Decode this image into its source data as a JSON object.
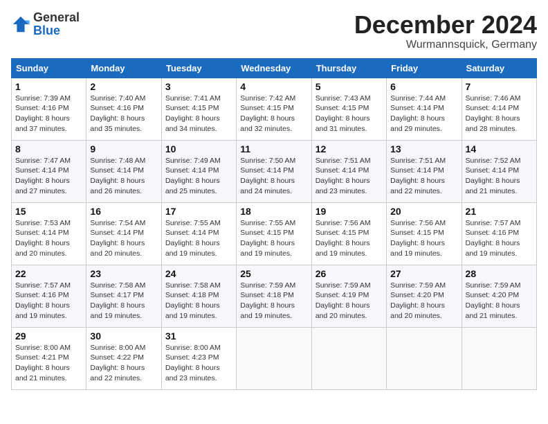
{
  "header": {
    "logo_general": "General",
    "logo_blue": "Blue",
    "month": "December 2024",
    "location": "Wurmannsquick, Germany"
  },
  "days_of_week": [
    "Sunday",
    "Monday",
    "Tuesday",
    "Wednesday",
    "Thursday",
    "Friday",
    "Saturday"
  ],
  "weeks": [
    [
      {
        "day": 1,
        "info": "Sunrise: 7:39 AM\nSunset: 4:16 PM\nDaylight: 8 hours\nand 37 minutes."
      },
      {
        "day": 2,
        "info": "Sunrise: 7:40 AM\nSunset: 4:16 PM\nDaylight: 8 hours\nand 35 minutes."
      },
      {
        "day": 3,
        "info": "Sunrise: 7:41 AM\nSunset: 4:15 PM\nDaylight: 8 hours\nand 34 minutes."
      },
      {
        "day": 4,
        "info": "Sunrise: 7:42 AM\nSunset: 4:15 PM\nDaylight: 8 hours\nand 32 minutes."
      },
      {
        "day": 5,
        "info": "Sunrise: 7:43 AM\nSunset: 4:15 PM\nDaylight: 8 hours\nand 31 minutes."
      },
      {
        "day": 6,
        "info": "Sunrise: 7:44 AM\nSunset: 4:14 PM\nDaylight: 8 hours\nand 29 minutes."
      },
      {
        "day": 7,
        "info": "Sunrise: 7:46 AM\nSunset: 4:14 PM\nDaylight: 8 hours\nand 28 minutes."
      }
    ],
    [
      {
        "day": 8,
        "info": "Sunrise: 7:47 AM\nSunset: 4:14 PM\nDaylight: 8 hours\nand 27 minutes."
      },
      {
        "day": 9,
        "info": "Sunrise: 7:48 AM\nSunset: 4:14 PM\nDaylight: 8 hours\nand 26 minutes."
      },
      {
        "day": 10,
        "info": "Sunrise: 7:49 AM\nSunset: 4:14 PM\nDaylight: 8 hours\nand 25 minutes."
      },
      {
        "day": 11,
        "info": "Sunrise: 7:50 AM\nSunset: 4:14 PM\nDaylight: 8 hours\nand 24 minutes."
      },
      {
        "day": 12,
        "info": "Sunrise: 7:51 AM\nSunset: 4:14 PM\nDaylight: 8 hours\nand 23 minutes."
      },
      {
        "day": 13,
        "info": "Sunrise: 7:51 AM\nSunset: 4:14 PM\nDaylight: 8 hours\nand 22 minutes."
      },
      {
        "day": 14,
        "info": "Sunrise: 7:52 AM\nSunset: 4:14 PM\nDaylight: 8 hours\nand 21 minutes."
      }
    ],
    [
      {
        "day": 15,
        "info": "Sunrise: 7:53 AM\nSunset: 4:14 PM\nDaylight: 8 hours\nand 20 minutes."
      },
      {
        "day": 16,
        "info": "Sunrise: 7:54 AM\nSunset: 4:14 PM\nDaylight: 8 hours\nand 20 minutes."
      },
      {
        "day": 17,
        "info": "Sunrise: 7:55 AM\nSunset: 4:14 PM\nDaylight: 8 hours\nand 19 minutes."
      },
      {
        "day": 18,
        "info": "Sunrise: 7:55 AM\nSunset: 4:15 PM\nDaylight: 8 hours\nand 19 minutes."
      },
      {
        "day": 19,
        "info": "Sunrise: 7:56 AM\nSunset: 4:15 PM\nDaylight: 8 hours\nand 19 minutes."
      },
      {
        "day": 20,
        "info": "Sunrise: 7:56 AM\nSunset: 4:15 PM\nDaylight: 8 hours\nand 19 minutes."
      },
      {
        "day": 21,
        "info": "Sunrise: 7:57 AM\nSunset: 4:16 PM\nDaylight: 8 hours\nand 19 minutes."
      }
    ],
    [
      {
        "day": 22,
        "info": "Sunrise: 7:57 AM\nSunset: 4:16 PM\nDaylight: 8 hours\nand 19 minutes."
      },
      {
        "day": 23,
        "info": "Sunrise: 7:58 AM\nSunset: 4:17 PM\nDaylight: 8 hours\nand 19 minutes."
      },
      {
        "day": 24,
        "info": "Sunrise: 7:58 AM\nSunset: 4:18 PM\nDaylight: 8 hours\nand 19 minutes."
      },
      {
        "day": 25,
        "info": "Sunrise: 7:59 AM\nSunset: 4:18 PM\nDaylight: 8 hours\nand 19 minutes."
      },
      {
        "day": 26,
        "info": "Sunrise: 7:59 AM\nSunset: 4:19 PM\nDaylight: 8 hours\nand 20 minutes."
      },
      {
        "day": 27,
        "info": "Sunrise: 7:59 AM\nSunset: 4:20 PM\nDaylight: 8 hours\nand 20 minutes."
      },
      {
        "day": 28,
        "info": "Sunrise: 7:59 AM\nSunset: 4:20 PM\nDaylight: 8 hours\nand 21 minutes."
      }
    ],
    [
      {
        "day": 29,
        "info": "Sunrise: 8:00 AM\nSunset: 4:21 PM\nDaylight: 8 hours\nand 21 minutes."
      },
      {
        "day": 30,
        "info": "Sunrise: 8:00 AM\nSunset: 4:22 PM\nDaylight: 8 hours\nand 22 minutes."
      },
      {
        "day": 31,
        "info": "Sunrise: 8:00 AM\nSunset: 4:23 PM\nDaylight: 8 hours\nand 23 minutes."
      },
      null,
      null,
      null,
      null
    ]
  ]
}
